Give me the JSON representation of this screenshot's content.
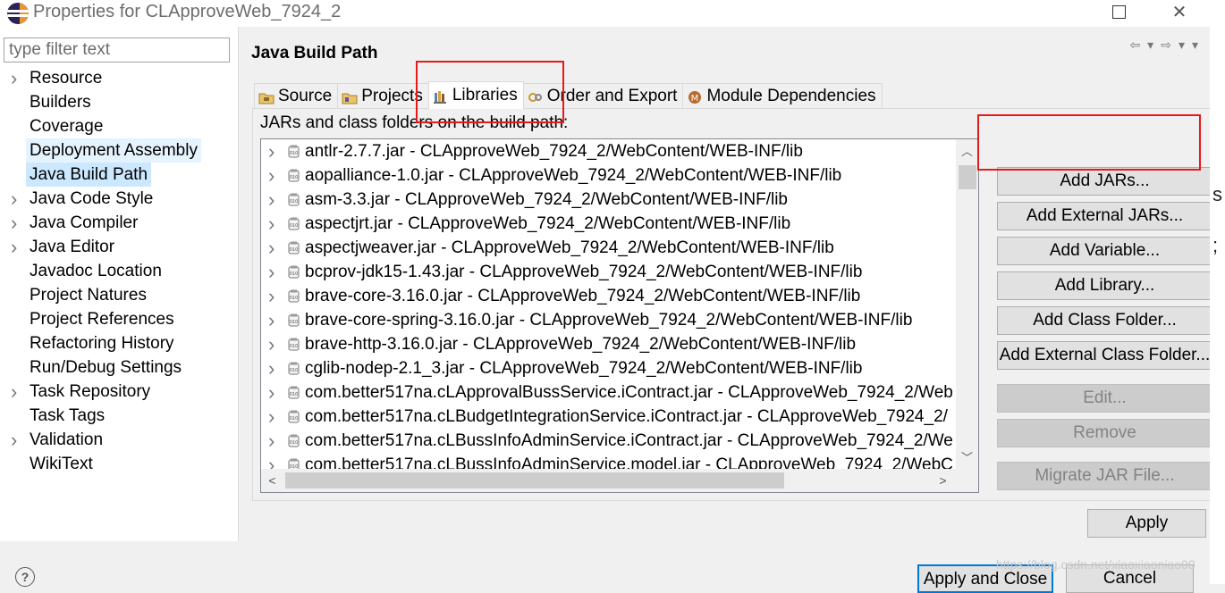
{
  "window": {
    "title": "Properties for CLApproveWeb_7924_2",
    "minimize_glyph": "",
    "close_glyph": "✕"
  },
  "filter": {
    "placeholder": "type filter text"
  },
  "tree": [
    {
      "label": "Resource",
      "expandable": true
    },
    {
      "label": "Builders",
      "expandable": false
    },
    {
      "label": "Coverage",
      "expandable": false
    },
    {
      "label": "Deployment Assembly",
      "expandable": false
    },
    {
      "label": "Java Build Path",
      "expandable": false
    },
    {
      "label": "Java Code Style",
      "expandable": true
    },
    {
      "label": "Java Compiler",
      "expandable": true
    },
    {
      "label": "Java Editor",
      "expandable": true
    },
    {
      "label": "Javadoc Location",
      "expandable": false
    },
    {
      "label": "Project Natures",
      "expandable": false
    },
    {
      "label": "Project References",
      "expandable": false
    },
    {
      "label": "Refactoring History",
      "expandable": false
    },
    {
      "label": "Run/Debug Settings",
      "expandable": false
    },
    {
      "label": "Task Repository",
      "expandable": true
    },
    {
      "label": "Task Tags",
      "expandable": false
    },
    {
      "label": "Validation",
      "expandable": true
    },
    {
      "label": "WikiText",
      "expandable": false
    }
  ],
  "tree_hover_index": 3,
  "tree_selected_index": 4,
  "section_title": "Java Build Path",
  "tabs": [
    {
      "label": "Source",
      "icon": "source-folder-icon"
    },
    {
      "label": "Projects",
      "icon": "projects-icon"
    },
    {
      "label": "Libraries",
      "icon": "libraries-icon",
      "active": true
    },
    {
      "label": "Order and Export",
      "icon": "order-export-icon"
    },
    {
      "label": "Module Dependencies",
      "icon": "module-icon"
    }
  ],
  "libraries": {
    "caption": "JARs and class folders on the build path:",
    "items": [
      "antlr-2.7.7.jar - CLApproveWeb_7924_2/WebContent/WEB-INF/lib",
      "aopalliance-1.0.jar - CLApproveWeb_7924_2/WebContent/WEB-INF/lib",
      "asm-3.3.jar - CLApproveWeb_7924_2/WebContent/WEB-INF/lib",
      "aspectjrt.jar - CLApproveWeb_7924_2/WebContent/WEB-INF/lib",
      "aspectjweaver.jar - CLApproveWeb_7924_2/WebContent/WEB-INF/lib",
      "bcprov-jdk15-1.43.jar - CLApproveWeb_7924_2/WebContent/WEB-INF/lib",
      "brave-core-3.16.0.jar - CLApproveWeb_7924_2/WebContent/WEB-INF/lib",
      "brave-core-spring-3.16.0.jar - CLApproveWeb_7924_2/WebContent/WEB-INF/lib",
      "brave-http-3.16.0.jar - CLApproveWeb_7924_2/WebContent/WEB-INF/lib",
      "cglib-nodep-2.1_3.jar - CLApproveWeb_7924_2/WebContent/WEB-INF/lib",
      "com.better517na.cLApprovalBussService.iContract.jar - CLApproveWeb_7924_2/Web",
      "com.better517na.cLBudgetIntegrationService.iContract.jar - CLApproveWeb_7924_2/",
      "com.better517na.cLBussInfoAdminService.iContract.jar - CLApproveWeb_7924_2/We",
      "com.better517na.cLBussInfoAdminService.model.jar - CLApproveWeb_7924_2/WebC"
    ]
  },
  "buttons": {
    "add_jars": "Add JARs...",
    "add_external_jars": "Add External JARs...",
    "add_variable": "Add Variable...",
    "add_library": "Add Library...",
    "add_class_folder": "Add Class Folder...",
    "add_external_class_folder": "Add External Class Folder...",
    "edit": "Edit...",
    "remove": "Remove",
    "migrate_jar": "Migrate JAR File...",
    "apply": "Apply",
    "apply_and_close": "Apply and Close",
    "cancel": "Cancel"
  },
  "help_glyph": "?",
  "watermark": "https://blog.csdn.net/xiaoxiaoniao00",
  "background_editor": {
    "chars": [
      "s",
      ";"
    ]
  },
  "colors": {
    "selection": "#cce8ff",
    "hover": "#e5f3ff",
    "annotation_red": "#e41b1b",
    "focus_blue": "#0078d7"
  }
}
